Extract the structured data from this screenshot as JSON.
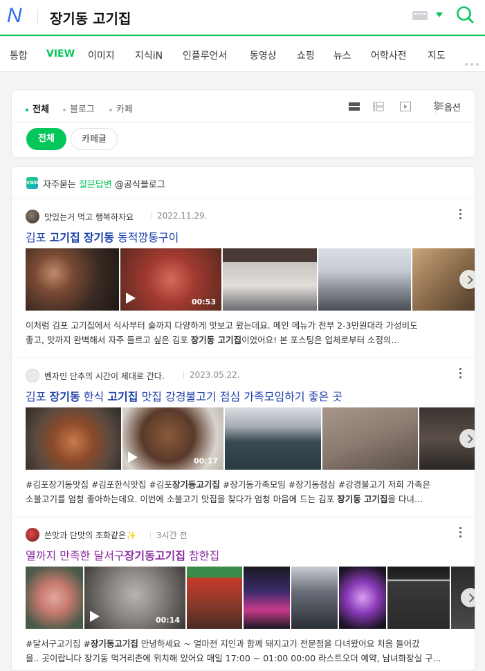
{
  "header": {
    "logo": "N",
    "query": "장기동 고기집",
    "colors": {
      "brand": "#03c75a",
      "logo": "#2f6be8"
    }
  },
  "tabs": [
    "통합",
    "VIEW",
    "이미지",
    "지식iN",
    "인플루언서",
    "동영상",
    "쇼핑",
    "뉴스",
    "어학사전",
    "지도"
  ],
  "active_tab": "VIEW",
  "filters": {
    "types": [
      "전체",
      "블로그",
      "카페"
    ],
    "active_type": "전체",
    "option_label": "옵션",
    "chips": [
      "전체",
      "카페글"
    ]
  },
  "results_header": {
    "prefix": "자주묻는 ",
    "highlight": "질문답변",
    "suffix": " @공식블로그",
    "badge": "VIEW"
  },
  "results": [
    {
      "author": "맛있는거 먹고 행복하자요",
      "date": "2022.11.29.",
      "title_parts": [
        {
          "t": "김포 ",
          "b": false
        },
        {
          "t": "고기집",
          "b": true
        },
        {
          "t": " ",
          "b": false
        },
        {
          "t": "장기동",
          "b": true
        },
        {
          "t": " 동적깡통구이",
          "b": false
        }
      ],
      "video_duration": "00:53",
      "snippet_1": "이처럼 김포 고기집에서 식사부터 술까지 다양하게 맛보고 왔는데요. 메인 메뉴가 전부 2-3만원대라 가성비도",
      "snippet_2a": "좋고, 맛까지 완벽해서 자주 들르고 싶은 김포 ",
      "snippet_2b": "장기동 고기집",
      "snippet_2c": "이었어요! 본 포스팅은 업체로부터 소정의...",
      "visited": false
    },
    {
      "author": "벤자민 단추의 시간이 제대로 간다.",
      "date": "2023.05.22.",
      "title_parts": [
        {
          "t": "김포 ",
          "b": false
        },
        {
          "t": "장기동",
          "b": true
        },
        {
          "t": " 한식 ",
          "b": false
        },
        {
          "t": "고기집",
          "b": true
        },
        {
          "t": " 맛집 강경불고기 점심 가족모임하기 좋은 곳",
          "b": false
        }
      ],
      "video_duration": "00:17",
      "snippet_1a": "#김포장기동맛집 #김포한식맛집 #김포",
      "snippet_1b": "장기동고기집",
      "snippet_1c": " #장기동가족모임 #장기동점심 #강경불고기 저희 가족은",
      "snippet_2a": "소불고기를 엄청 좋아하는데요. 이번에 소불고기 맛집을 찾다가 엄청 마음에 드는 김포 ",
      "snippet_2b": "장기동 고기집",
      "snippet_2c": "을 다녀...",
      "visited": false
    },
    {
      "author": "쓴맛과 단맛의 조화같은✨",
      "date": "3시간 전",
      "title_parts": [
        {
          "t": "열까지 만족한 달서구",
          "b": false
        },
        {
          "t": "장기동고기집",
          "b": true
        },
        {
          "t": " 참한집",
          "b": false
        }
      ],
      "video_duration": "00:14",
      "snippet_1a": "#달서구고기집 #",
      "snippet_1b": "장기동고기집",
      "snippet_1c": " 안녕하세요 ~ 얼마전 지인과 함께 돼지고기 전문점을 다녀왔어요 처음 들어갔",
      "snippet_2": "을.. 곳이랍니다 장기동 먹거리촌에 위치해 있어요 매일 17:00 ~ 01:00 00:00 라스트오더 예약, 남녀화장실 구...",
      "visited": true
    }
  ]
}
